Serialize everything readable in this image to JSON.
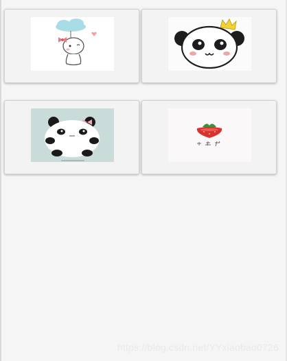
{
  "grid": {
    "items": [
      {
        "icon": "cloud-girl-icon"
      },
      {
        "icon": "crowned-panda-icon"
      },
      {
        "icon": "round-panda-icon"
      },
      {
        "icon": "strawberry-icon"
      }
    ]
  },
  "watermark": {
    "text": "https://blog.csdn.net/YYxiaobao0726"
  },
  "colors": {
    "background": "#f5f5f5",
    "card": "#f3f3f3",
    "card_border": "#d2d2d2"
  }
}
